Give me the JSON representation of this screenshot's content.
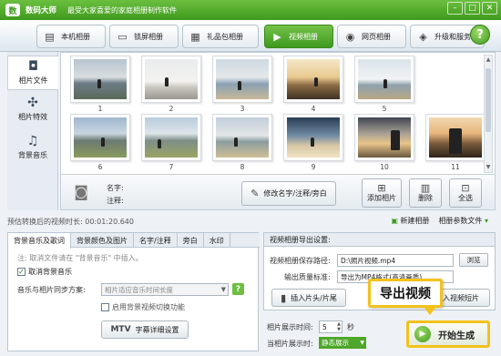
{
  "titlebar": {
    "logo": "数",
    "app_name": "数码大师",
    "slogan": "最受大家喜爱的家庭相册制作软件",
    "min": "–",
    "max": "□",
    "close": "✕"
  },
  "toolbar": {
    "tabs": [
      {
        "label": "本机相册",
        "icon": "album-icon"
      },
      {
        "label": "锁屏相册",
        "icon": "monitor-icon"
      },
      {
        "label": "礼品包相册",
        "icon": "gift-icon"
      },
      {
        "label": "视频相册",
        "icon": "video-icon"
      },
      {
        "label": "网页相册",
        "icon": "globe-icon"
      },
      {
        "label": "升级和服务",
        "icon": "service-icon"
      }
    ],
    "active_tab": "视频相册",
    "help": "?"
  },
  "leftnav": {
    "items": [
      {
        "label": "相片文件",
        "icon": "camera-icon"
      },
      {
        "label": "相片特效",
        "icon": "effects-icon"
      },
      {
        "label": "背景音乐",
        "icon": "music-icon"
      }
    ]
  },
  "gallery": {
    "photos": [
      "1",
      "2",
      "3",
      "4",
      "5",
      "6",
      "7",
      "8",
      "9",
      "10",
      "11"
    ]
  },
  "info": {
    "name_label": "名字:",
    "note_label": "注释:",
    "edit_label": "修改名字/注释/旁白",
    "add_label": "添加相片",
    "delete_label": "删除",
    "select_all_label": "全选"
  },
  "status": {
    "estimate": "预估转换后的视频时长: 00:01:20.640",
    "new_album": "新建相册",
    "album_param": "相册参数文件"
  },
  "left_panel": {
    "tabs": [
      "背景音乐及歌词",
      "背景颜色及图片",
      "名字/注释",
      "旁白",
      "水印"
    ],
    "hint": "注: 取消文件请在 \"背景音乐\" 中插入。",
    "cancel_music": "取消背景音乐",
    "sync_label": "音乐与相片同步方案:",
    "sync_value": "相片适应音乐时间长度",
    "sync_help": "?",
    "enable_switch": "启用背景视频切换功能",
    "mtv_label": "MTV",
    "lyrics_label": "字幕详细设置"
  },
  "right_panel": {
    "title": "视频相册导出设置:",
    "save_path_label": "视频相册保存路径:",
    "save_path_value": "D:\\照片视频.mp4",
    "browse": "浏览",
    "quality_label": "输出质量标准:",
    "quality_value": "导出为MP4格式(高清画质)",
    "insert_label": "插入片头/片尾",
    "short_label": "视频短片",
    "short_prefix": "入",
    "duration_label": "相片展示时间:",
    "duration_value": "5",
    "duration_unit": "秒",
    "display_label": "当相片展示时:",
    "display_value": "静态展示",
    "callout": "导出视频",
    "start": "开始生成"
  }
}
